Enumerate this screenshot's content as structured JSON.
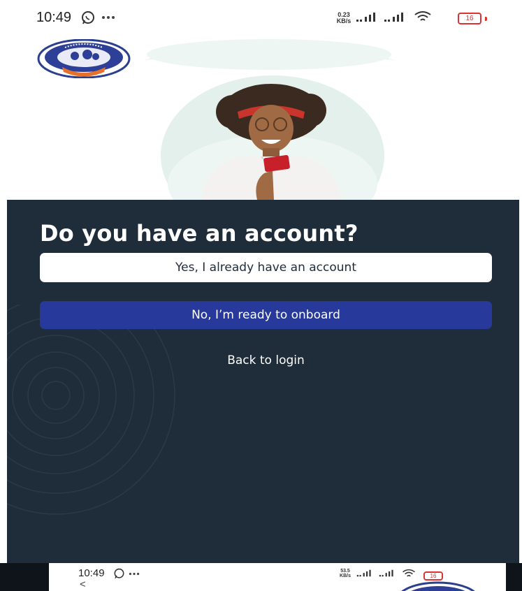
{
  "status_bar": {
    "time": "10:49",
    "data_speed_value": "0.23",
    "data_speed_unit": "KB/s",
    "battery": "16",
    "icons": [
      "whatsapp-icon",
      "more-dots-icon",
      "signal-icon",
      "signal-icon",
      "wifi-icon",
      "battery-icon"
    ]
  },
  "logo": {
    "ring_text": "FEDERAL POLYTECHNIC NEKEDE OWERRI",
    "ribbon_text": "MICRO FINANCE BANK"
  },
  "onboarding": {
    "question": "Do you have an account?",
    "yes_label": "Yes, I already have an account",
    "no_label": "No, I’m ready to onboard",
    "back_label": "Back to login"
  },
  "second_screenshot": {
    "time": "10:49",
    "data_speed_value": "53.5",
    "data_speed_unit": "KB/s",
    "battery": "16",
    "back_glyph": "<"
  },
  "colors": {
    "panel_bg": "#1f2c3a",
    "primary_button": "#27399b",
    "secondary_button": "#ffffff",
    "hero_halo": "#e6f2ef",
    "battery_low": "#dd3333"
  }
}
